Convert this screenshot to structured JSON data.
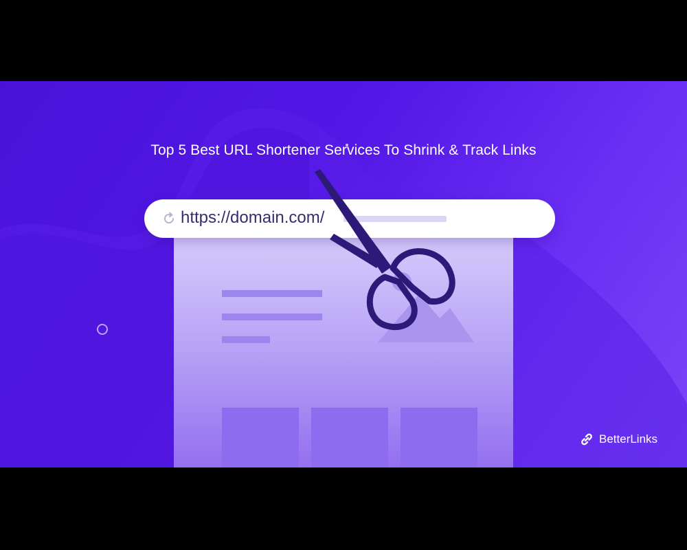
{
  "title": "Top 5 Best URL Shortener Services To Shrink & Track Links",
  "url_bar": {
    "url": "https://domain.com/"
  },
  "brand": {
    "name": "BetterLinks"
  },
  "icons": {
    "refresh": "refresh-icon",
    "scissors": "scissors-icon",
    "brand_logo": "link-icon"
  },
  "colors": {
    "background_start": "#4a12d9",
    "background_end": "#7b45f7",
    "url_text": "#3a2a72",
    "scissors": "#2d1a78",
    "page_mock": "#c9baf8"
  }
}
